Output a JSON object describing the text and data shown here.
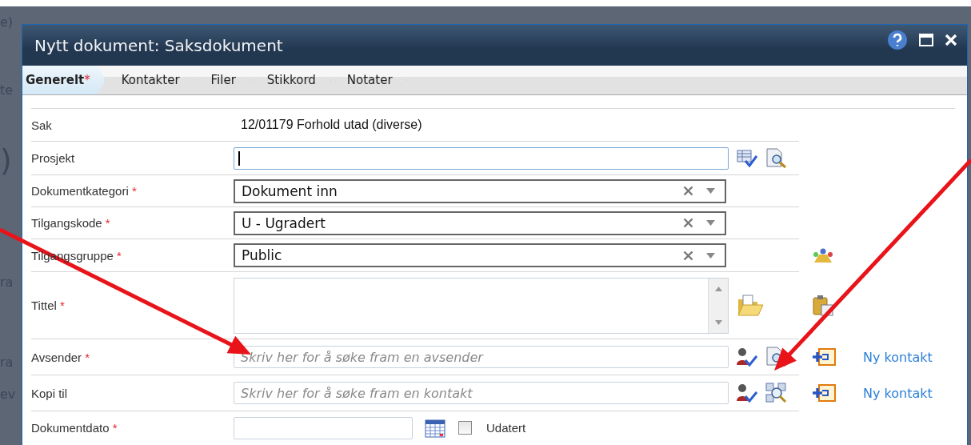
{
  "background_page": {
    "fragments": [
      "e)",
      "te",
      ")",
      "ra",
      "ra",
      "ev"
    ]
  },
  "window": {
    "title": "Nytt dokument: Saksdokument"
  },
  "tabs": [
    {
      "label": "Generelt",
      "mark": "*",
      "selected": true
    },
    {
      "label": "Kontakter",
      "selected": false
    },
    {
      "label": "Filer",
      "selected": false
    },
    {
      "label": "Stikkord",
      "selected": false
    },
    {
      "label": "Notater",
      "selected": false
    }
  ],
  "fields": [
    {
      "kind": "static",
      "label": "Sak",
      "value": "12/01179 Forhold utad (diverse)"
    },
    {
      "kind": "text",
      "label": "Prosjekt",
      "focused": true
    },
    {
      "kind": "select",
      "label": "Dokumentkategori",
      "mark": "*",
      "value": "Dokument inn"
    },
    {
      "kind": "select",
      "label": "Tilgangskode",
      "mark": "*",
      "value": "U - Ugradert"
    },
    {
      "kind": "select",
      "label": "Tilgangsgruppe",
      "mark": "*",
      "value": "Public"
    },
    {
      "kind": "textarea",
      "label": "Tittel",
      "mark": "*"
    },
    {
      "kind": "search",
      "label": "Avsender",
      "mark": "*",
      "focused": false,
      "placeholder": "Skriv her for å søke fram en avsender",
      "link": "Ny kontakt"
    },
    {
      "kind": "search",
      "label": "Kopi til",
      "focused": false,
      "placeholder": "Skriv her for å søke fram en kontakt",
      "link": "Ny kontakt"
    },
    {
      "kind": "date",
      "label": "Dokumentdato",
      "mark": "*",
      "checkbox_label": "Udatert",
      "checked": false
    }
  ]
}
